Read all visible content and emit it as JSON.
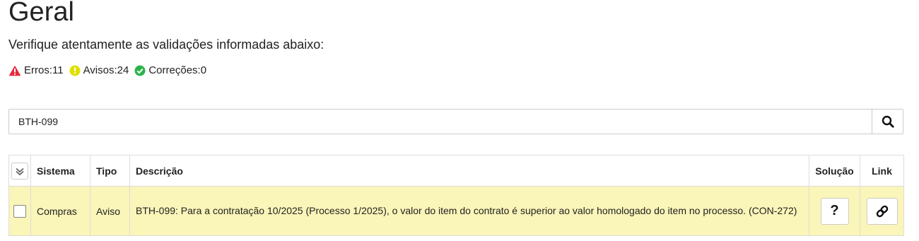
{
  "page": {
    "title": "Geral",
    "subtitle": "Verifique atentamente as validações informadas abaixo:"
  },
  "counters": {
    "errors": "Erros:11",
    "warnings": "Avisos:24",
    "corrections": "Correções:0"
  },
  "colors": {
    "error": "#e8273a",
    "warning": "#e0e000",
    "success": "#2bb34a",
    "row_highlight": "#faf5b8"
  },
  "search": {
    "value": "BTH-099",
    "button_icon": "search-icon"
  },
  "table": {
    "headers": {
      "select_all_icon": "double-check-icon",
      "sistema": "Sistema",
      "tipo": "Tipo",
      "descricao": "Descrição",
      "solucao": "Solução",
      "link": "Link"
    },
    "rows": [
      {
        "sistema": "Compras",
        "tipo": "Aviso",
        "descricao": "BTH-099: Para a contratação 10/2025 (Processo 1/2025), o valor do item do contrato é superior ao valor homologado do item no processo. (CON-272)",
        "solucao_label": "?",
        "link_icon": "link-icon"
      }
    ]
  }
}
